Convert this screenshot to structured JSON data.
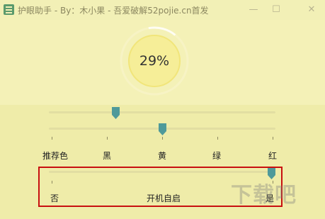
{
  "window": {
    "title": "护眼助手 - By：木小果 - 吾爱破解52pojie.cn首发",
    "minimize_glyph": "—",
    "maximize_glyph": "☐",
    "close_glyph": "✕"
  },
  "gauge": {
    "percent_text": "29%",
    "value": 0.29
  },
  "sliders": {
    "slider1_value": 0.33,
    "slider2_value": 0.5
  },
  "color_labels": [
    "推荐色",
    "黑",
    "黄",
    "绿",
    "红"
  ],
  "autostart": {
    "label": "开机自启",
    "off_label": "否",
    "on_label": "是",
    "value": 1
  },
  "watermark": "下载吧",
  "colors": {
    "background": "#f3f0b4",
    "thumb": "#4f9a9a",
    "highlight": "#c81010",
    "gauge_ring": "#f5e98c"
  }
}
